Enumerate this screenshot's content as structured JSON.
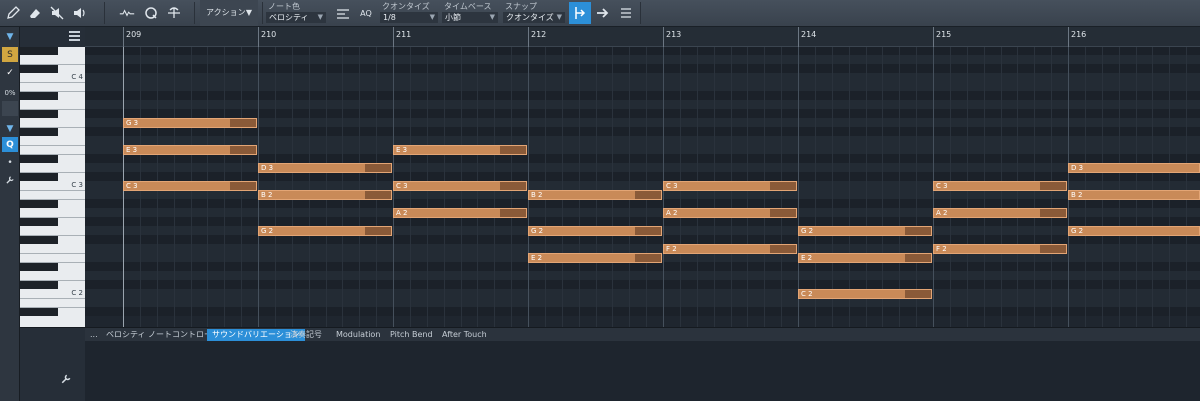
{
  "toolbar": {
    "action_label": "アクション",
    "note_color_label": "ノート色",
    "note_color_value": "ベロシティ",
    "aq_label": "AQ",
    "quantize_label": "クオンタイズ",
    "quantize_value": "1/8",
    "timebase_label": "タイムベース",
    "timebase_value": "小節",
    "snap_label": "スナップ",
    "snap_value": "クオンタイズ"
  },
  "left_strip": {
    "solo_label": "S",
    "percent_label": "0%"
  },
  "ruler": {
    "bars": [
      "209",
      "210",
      "211",
      "212",
      "213",
      "214",
      "215",
      "216"
    ]
  },
  "keys": {
    "labels": [
      "C 4",
      "C 3",
      "C 2"
    ]
  },
  "notes": [
    {
      "label": "G 3"
    },
    {
      "label": "E 3"
    },
    {
      "label": "C 3"
    },
    {
      "label": "D 3"
    },
    {
      "label": "B 2"
    },
    {
      "label": "G 2"
    },
    {
      "label": "E 3"
    },
    {
      "label": "C 3"
    },
    {
      "label": "A 2"
    },
    {
      "label": "B 2"
    },
    {
      "label": "G 2"
    },
    {
      "label": "E 2"
    },
    {
      "label": "C 3"
    },
    {
      "label": "A 2"
    },
    {
      "label": "F 2"
    },
    {
      "label": "G 2"
    },
    {
      "label": "E 2"
    },
    {
      "label": "C 2"
    },
    {
      "label": "C 3"
    },
    {
      "label": "A 2"
    },
    {
      "label": "F 2"
    },
    {
      "label": "D 3"
    },
    {
      "label": "B 2"
    },
    {
      "label": "G 2"
    }
  ],
  "lower_tabs": {
    "more": "...",
    "items": [
      "ベロシティ",
      "ノートコントローラー",
      "サウンドバリエーション",
      "演奏記号",
      "Modulation",
      "Pitch Bend",
      "After Touch"
    ],
    "active": "サウンドバリエーション"
  },
  "colors": {
    "note_fill": "#c98a58",
    "accent": "#2c8fd8"
  }
}
